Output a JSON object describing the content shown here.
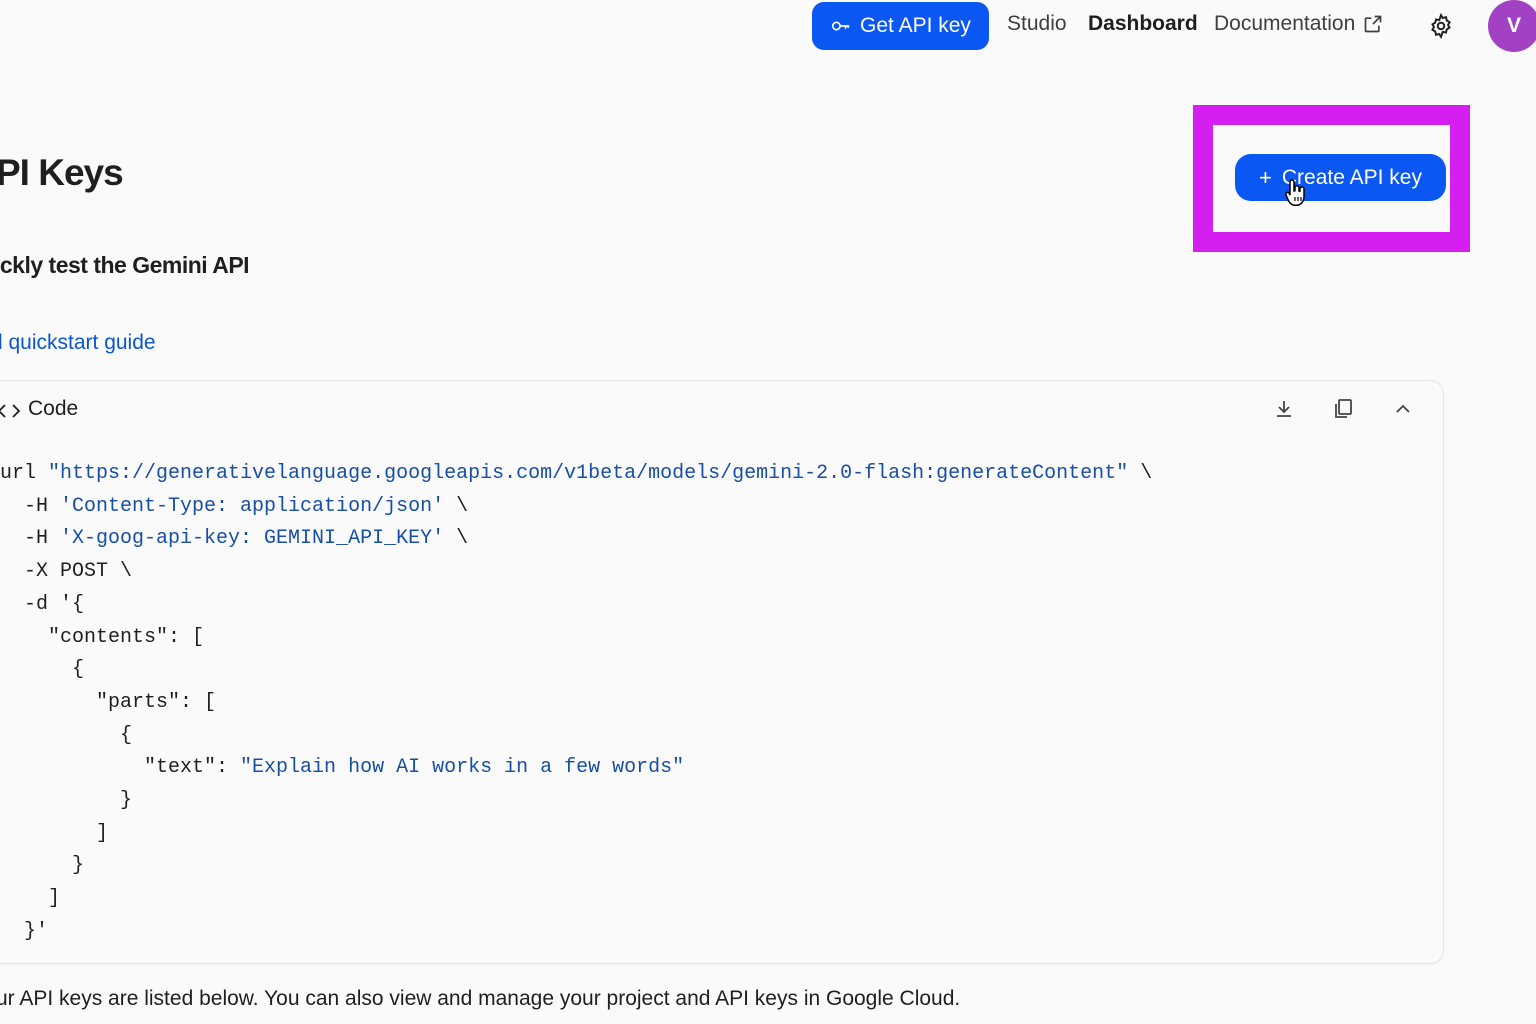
{
  "nav": {
    "get_api_key": "Get API key",
    "studio": "Studio",
    "dashboard": "Dashboard",
    "documentation": "Documentation",
    "avatar_initial": "V",
    "icons": {
      "key": "key-icon",
      "external": "external-link-icon",
      "settings": "gear-icon"
    }
  },
  "page": {
    "title": "PI Keys",
    "create_button": "Create API key",
    "subheading": "ickly test the Gemini API",
    "quickstart_link": "l quickstart guide",
    "footer_note": "ur API keys are listed below. You can also view and manage your project and API keys in Google Cloud."
  },
  "code_panel": {
    "title": "Code",
    "lines": [
      {
        "pre": "url ",
        "str": "\"https://generativelanguage.googleapis.com/v1beta/models/gemini-2.0-flash:generateContent\"",
        "post": " \\"
      },
      {
        "pre": "  -H ",
        "str": "'Content-Type: application/json'",
        "post": " \\"
      },
      {
        "pre": "  -H ",
        "str": "'X-goog-api-key: GEMINI_API_KEY'",
        "post": " \\"
      },
      {
        "pre": "  -X POST \\",
        "str": "",
        "post": ""
      },
      {
        "pre": "  -d '{",
        "str": "",
        "post": ""
      },
      {
        "pre": "    \"contents\": [",
        "str": "",
        "post": ""
      },
      {
        "pre": "      {",
        "str": "",
        "post": ""
      },
      {
        "pre": "        \"parts\": [",
        "str": "",
        "post": ""
      },
      {
        "pre": "          {",
        "str": "",
        "post": ""
      },
      {
        "pre": "            \"text\": ",
        "str": "\"Explain how AI works in a few words\"",
        "post": ""
      },
      {
        "pre": "          }",
        "str": "",
        "post": ""
      },
      {
        "pre": "        ]",
        "str": "",
        "post": ""
      },
      {
        "pre": "      }",
        "str": "",
        "post": ""
      },
      {
        "pre": "    ]",
        "str": "",
        "post": ""
      },
      {
        "pre": "  }'",
        "str": "",
        "post": ""
      }
    ]
  },
  "colors": {
    "primary": "#0b57f4",
    "highlight": "#d41ff0",
    "link": "#0b57d0",
    "avatar": "#a341c4"
  }
}
